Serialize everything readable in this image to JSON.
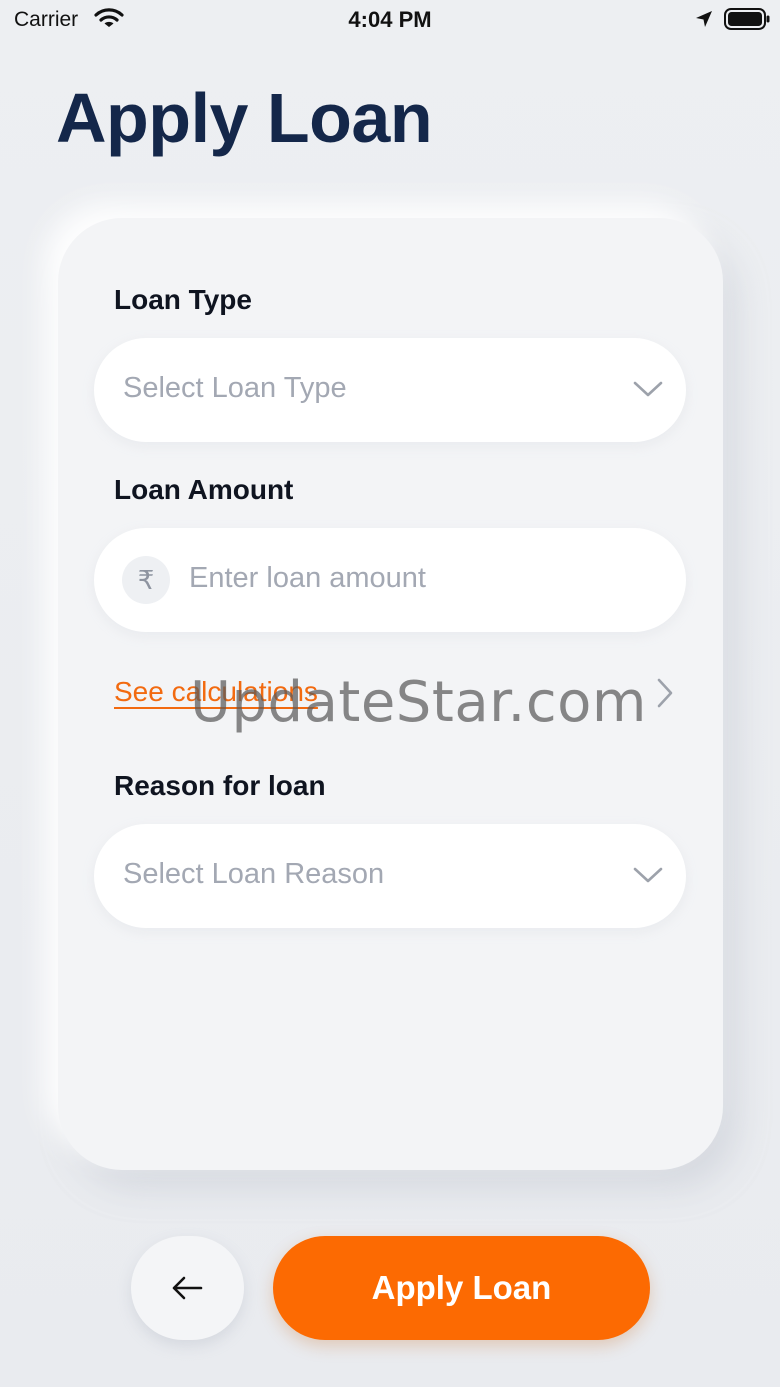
{
  "status_bar": {
    "carrier": "Carrier",
    "time": "4:04 PM",
    "icons": [
      "wifi-icon",
      "location-icon",
      "battery-icon"
    ]
  },
  "page": {
    "title": "Apply Loan"
  },
  "form": {
    "loan_type": {
      "label": "Loan Type",
      "placeholder": "Select Loan Type",
      "icon": "chevron-down-icon"
    },
    "loan_amount": {
      "label": "Loan Amount",
      "currency_symbol": "₹",
      "placeholder": "Enter loan amount"
    },
    "calculations_link": {
      "label": "See calculations",
      "icon": "chevron-right-icon"
    },
    "reason": {
      "label": "Reason for loan",
      "placeholder": "Select Loan Reason",
      "icon": "chevron-down-icon"
    }
  },
  "actions": {
    "back_icon": "arrow-left-icon",
    "apply_label": "Apply Loan"
  },
  "watermark": "UpdateStar.com",
  "colors": {
    "accent": "#fc6a02",
    "link": "#f26a10",
    "title": "#14274a",
    "placeholder": "#a3a8b3",
    "background": "#eceef2",
    "card": "#f3f4f6"
  }
}
